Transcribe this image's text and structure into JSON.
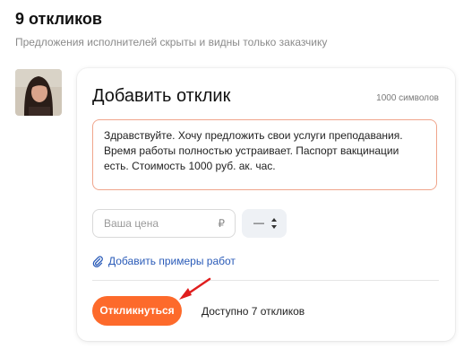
{
  "header": {
    "title": "9 откликов",
    "subtitle": "Предложения исполнителей скрыты и видны только заказчику"
  },
  "response_form": {
    "title": "Добавить отклик",
    "char_limit": "1000 символов",
    "message": "Здравствуйте. Хочу предложить свои услуги преподавания. Время работы полностью устраивает. Паспорт вакцинации есть. Стоимость 1000 руб. ак. час.",
    "price_placeholder": "Ваша цена",
    "currency_symbol": "₽",
    "unit_value": "—",
    "add_works_label": "Добавить примеры работ",
    "submit_label": "Откликнуться",
    "available_text": "Доступно 7 откликов"
  },
  "colors": {
    "accent": "#fd6a2b",
    "link": "#2a5bb8",
    "annotation_arrow": "#e01e1e"
  },
  "icons": {
    "avatar": "user-photo",
    "attach": "paperclip-icon",
    "unit_toggle": "updown-arrows-icon"
  }
}
